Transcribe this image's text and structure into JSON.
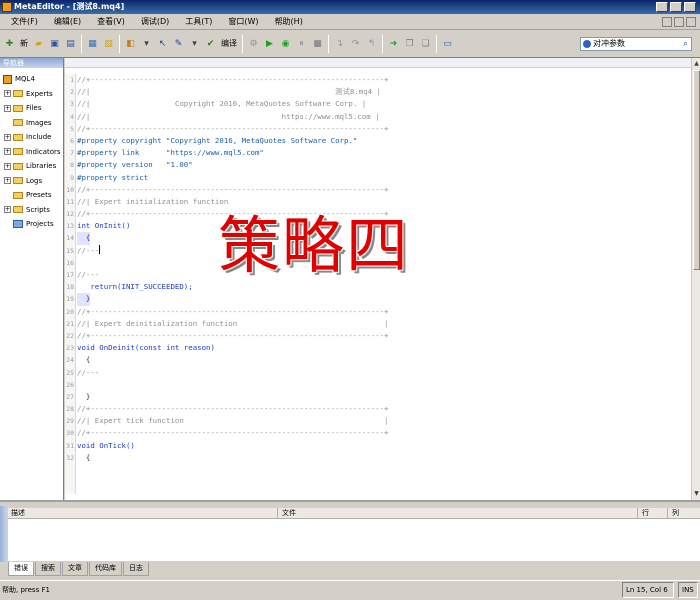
{
  "window": {
    "title": "MetaEditor - [测试8.mq4]"
  },
  "menu": {
    "items": [
      "文件(F)",
      "编辑(E)",
      "查看(V)",
      "调试(D)",
      "工具(T)",
      "窗口(W)",
      "帮助(H)"
    ]
  },
  "toolbar": {
    "new_label": "新",
    "compile_label": "编译",
    "search_value": "对冲参数"
  },
  "navigator": {
    "title": "导航器",
    "root": "MQL4",
    "items": [
      "Experts",
      "Files",
      "Images",
      "Include",
      "Indicators",
      "Libraries",
      "Logs",
      "Presets",
      "Scripts",
      "Projects"
    ]
  },
  "editor": {
    "lines": [
      {
        "n": "1",
        "t": "//+------------------------------------------------------------------+",
        "c": "c-comment"
      },
      {
        "n": "2",
        "t": "//|                                                       测试8.mq4 |",
        "c": "c-comment"
      },
      {
        "n": "3",
        "t": "//|                   Copyright 2016, MetaQuotes Software Corp. |",
        "c": "c-comment"
      },
      {
        "n": "4",
        "t": "//|                                           https://www.mql5.com |",
        "c": "c-comment"
      },
      {
        "n": "5",
        "t": "//+------------------------------------------------------------------+",
        "c": "c-comment"
      },
      {
        "n": "6",
        "t": "#property copyright \"Copyright 2016, MetaQuotes Software Corp.\"",
        "c": "c-prop"
      },
      {
        "n": "7",
        "t": "#property link      \"https://www.mql5.com\"",
        "c": "c-prop"
      },
      {
        "n": "8",
        "t": "#property version   \"1.00\"",
        "c": "c-prop"
      },
      {
        "n": "9",
        "t": "#property strict",
        "c": "c-prop"
      },
      {
        "n": "10",
        "t": "//+------------------------------------------------------------------+",
        "c": "c-comment"
      },
      {
        "n": "11",
        "t": "//| Expert initialization function",
        "c": "c-comment"
      },
      {
        "n": "12",
        "t": "//+------------------------------------------------------------------+",
        "c": "c-comment"
      },
      {
        "n": "13",
        "t": "int OnInit()",
        "c": "c-kw"
      },
      {
        "n": "14",
        "t": "  {",
        "c": "c-brace"
      },
      {
        "n": "15",
        "t": "//---",
        "c": "c-comment",
        "cursor": true
      },
      {
        "n": "16",
        "t": "",
        "c": "code-text"
      },
      {
        "n": "17",
        "t": "//---",
        "c": "c-comment"
      },
      {
        "n": "18",
        "t": "   return(INIT_SUCCEEDED);",
        "c": "c-kw"
      },
      {
        "n": "19",
        "t": "  }",
        "c": "c-brace"
      },
      {
        "n": "20",
        "t": "//+------------------------------------------------------------------+",
        "c": "c-comment"
      },
      {
        "n": "21",
        "t": "//| Expert deinitialization function                                 |",
        "c": "c-comment"
      },
      {
        "n": "22",
        "t": "//+------------------------------------------------------------------+",
        "c": "c-comment"
      },
      {
        "n": "23",
        "t": "void OnDeinit(const int reason)",
        "c": "c-kw"
      },
      {
        "n": "24",
        "t": "  {",
        "c": "code-text"
      },
      {
        "n": "25",
        "t": "//---",
        "c": "c-comment"
      },
      {
        "n": "26",
        "t": "",
        "c": "code-text"
      },
      {
        "n": "27",
        "t": "  }",
        "c": "code-text"
      },
      {
        "n": "28",
        "t": "//+------------------------------------------------------------------+",
        "c": "c-comment"
      },
      {
        "n": "29",
        "t": "//| Expert tick function                                             |",
        "c": "c-comment"
      },
      {
        "n": "30",
        "t": "//+------------------------------------------------------------------+",
        "c": "c-comment"
      },
      {
        "n": "31",
        "t": "void OnTick()",
        "c": "c-kw"
      },
      {
        "n": "32",
        "t": "  {",
        "c": "code-text"
      }
    ]
  },
  "overlay": {
    "text": "策略四",
    "color": "#e00000"
  },
  "toolbox": {
    "columns": {
      "description": "描述",
      "file": "文件",
      "line": "行",
      "column": "列"
    },
    "tabs": [
      "错误",
      "搜索",
      "文章",
      "代码库",
      "日志"
    ]
  },
  "status": {
    "help": "帮助, press F1",
    "position": "Ln 15, Col 6",
    "mode": "INS"
  }
}
